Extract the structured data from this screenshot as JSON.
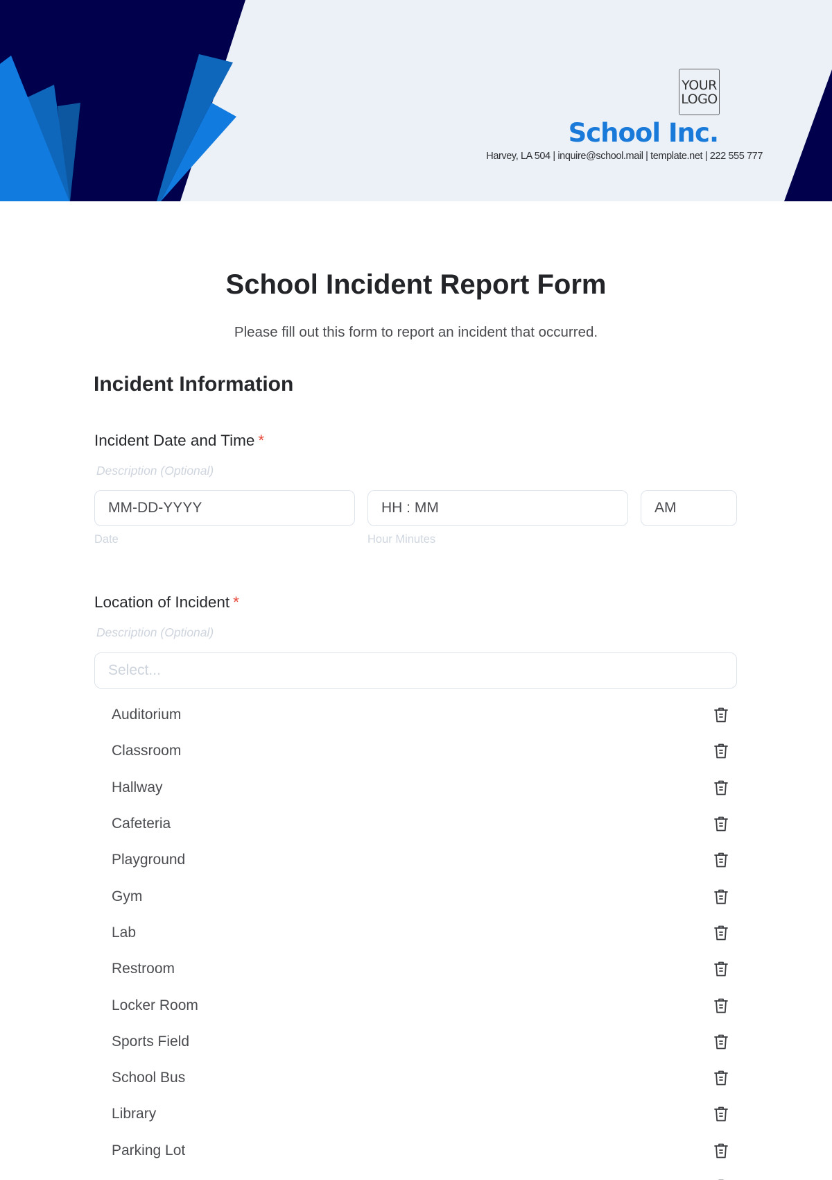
{
  "header": {
    "logo_line1": "YOUR",
    "logo_line2": "LOGO",
    "company_name": "School Inc.",
    "contact": "Harvey, LA 504 | inquire@school.mail | template.net | 222 555 777",
    "colors": {
      "navy": "#00004d",
      "blue_bright": "#117be0",
      "blue_mid": "#0e67bb",
      "blue_dark": "#0d57a0",
      "background": "#ecf1f7",
      "brand_text": "#1a7ad9"
    }
  },
  "form": {
    "title": "School Incident Report Form",
    "subtitle": "Please fill out this form to report an incident that occurred.",
    "section_title": "Incident Information",
    "date_time": {
      "label": "Incident Date and Time",
      "required_mark": "*",
      "description": "Description (Optional)",
      "date_placeholder": "MM-DD-YYYY",
      "date_sublabel": "Date",
      "time_placeholder": "HH : MM",
      "time_sublabel": "Hour Minutes",
      "ampm_value": "AM"
    },
    "location": {
      "label": "Location of Incident",
      "required_mark": "*",
      "description": "Description (Optional)",
      "select_placeholder": "Select...",
      "options": [
        {
          "label": "Auditorium",
          "icon": "trash-icon"
        },
        {
          "label": "Classroom",
          "icon": "trash-icon"
        },
        {
          "label": "Hallway",
          "icon": "trash-icon"
        },
        {
          "label": "Cafeteria",
          "icon": "trash-icon"
        },
        {
          "label": "Playground",
          "icon": "trash-icon"
        },
        {
          "label": "Gym",
          "icon": "trash-icon"
        },
        {
          "label": "Lab",
          "icon": "trash-icon"
        },
        {
          "label": "Restroom",
          "icon": "trash-icon"
        },
        {
          "label": "Locker Room",
          "icon": "trash-icon"
        },
        {
          "label": "Sports Field",
          "icon": "trash-icon"
        },
        {
          "label": "School Bus",
          "icon": "trash-icon"
        },
        {
          "label": "Library",
          "icon": "trash-icon"
        },
        {
          "label": "Parking Lot",
          "icon": "trash-icon"
        },
        {
          "label": "",
          "icon": "trash-icon"
        }
      ]
    },
    "colors": {
      "required": "#e8493b",
      "border": "#dde3ea",
      "muted": "#cfd5de"
    }
  }
}
